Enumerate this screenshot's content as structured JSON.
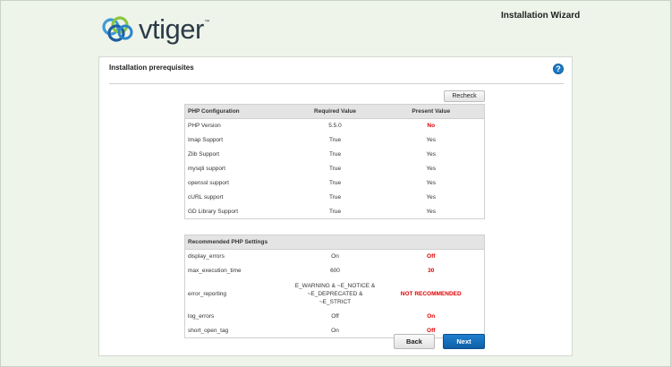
{
  "header": {
    "logo_text": "vtiger",
    "logo_tm": "™",
    "wizard_title": "Installation Wizard"
  },
  "panel": {
    "title": "Installation prerequisites",
    "help_glyph": "?",
    "recheck_label": "Recheck"
  },
  "php_config": {
    "headers": [
      "PHP Configuration",
      "Required Value",
      "Present Value"
    ],
    "rows": [
      {
        "name": "PHP Version",
        "required": "5.5.0",
        "present": "No",
        "bad": true
      },
      {
        "name": "Imap Support",
        "required": "True",
        "present": "Yes",
        "bad": false
      },
      {
        "name": "Zlib Support",
        "required": "True",
        "present": "Yes",
        "bad": false
      },
      {
        "name": "mysqli support",
        "required": "True",
        "present": "Yes",
        "bad": false
      },
      {
        "name": "openssl support",
        "required": "True",
        "present": "Yes",
        "bad": false
      },
      {
        "name": "cURL support",
        "required": "True",
        "present": "Yes",
        "bad": false
      },
      {
        "name": "GD Library Support",
        "required": "True",
        "present": "Yes",
        "bad": false
      }
    ]
  },
  "recommended": {
    "header": "Recommended PHP Settings",
    "rows": [
      {
        "name": "display_errors",
        "required": "On",
        "present": "Off",
        "bad": true
      },
      {
        "name": "max_execution_time",
        "required": "600",
        "present": "30",
        "bad": true
      },
      {
        "name": "error_reporting",
        "required_line1": "E_WARNING & ~E_NOTICE &",
        "required_line2": "~E_DEPRECATED & ~E_STRICT",
        "present": "NOT RECOMMENDED",
        "bad": true
      },
      {
        "name": "log_errors",
        "required": "Off",
        "present": "On",
        "bad": true
      },
      {
        "name": "short_open_tag",
        "required": "On",
        "present": "Off",
        "bad": true
      }
    ]
  },
  "footer": {
    "back_label": "Back",
    "next_label": "Next"
  },
  "colors": {
    "background": "#eef4ea",
    "accent": "#1d7ac8",
    "error": "#e00000",
    "next_button": "#1570be"
  }
}
